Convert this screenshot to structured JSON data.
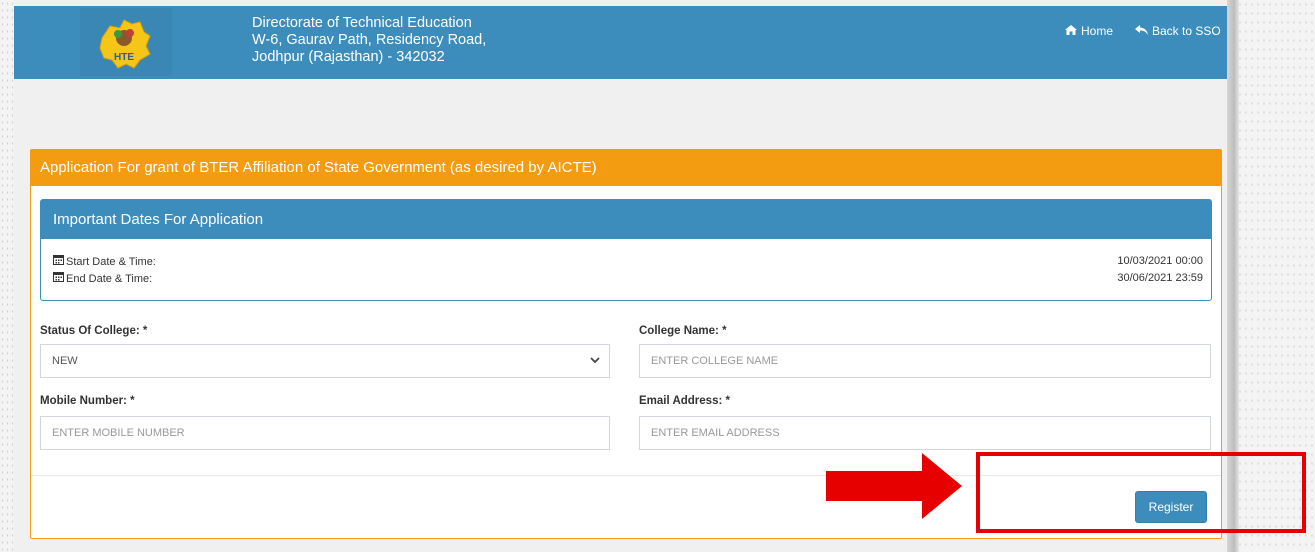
{
  "header": {
    "org_line1": "Directorate of Technical Education",
    "org_line2": "W-6, Gaurav Path, Residency Road,",
    "org_line3": "Jodhpur (Rajasthan) - 342032",
    "home_label": "Home",
    "sso_label": "Back to SSO",
    "logo_text": "HTE"
  },
  "panel": {
    "title": "Application For grant of BTER Affiliation of State Government (as desired by AICTE)"
  },
  "dates": {
    "title": "Important Dates For Application",
    "start_label": "Start Date & Time:",
    "start_value": "10/03/2021 00:00",
    "end_label": "End Date & Time:",
    "end_value": "30/06/2021 23:59"
  },
  "form": {
    "status_label": "Status Of College: *",
    "status_value": "NEW",
    "college_label": "College Name: *",
    "college_placeholder": "ENTER COLLEGE NAME",
    "mobile_label": "Mobile Number: *",
    "mobile_placeholder": "ENTER MOBILE NUMBER",
    "email_label": "Email Address: *",
    "email_placeholder": "ENTER EMAIL ADDRESS",
    "register_label": "Register"
  },
  "colors": {
    "header_blue": "#3c8dbc",
    "panel_orange": "#f39c12",
    "annotation_red": "#e60000"
  }
}
